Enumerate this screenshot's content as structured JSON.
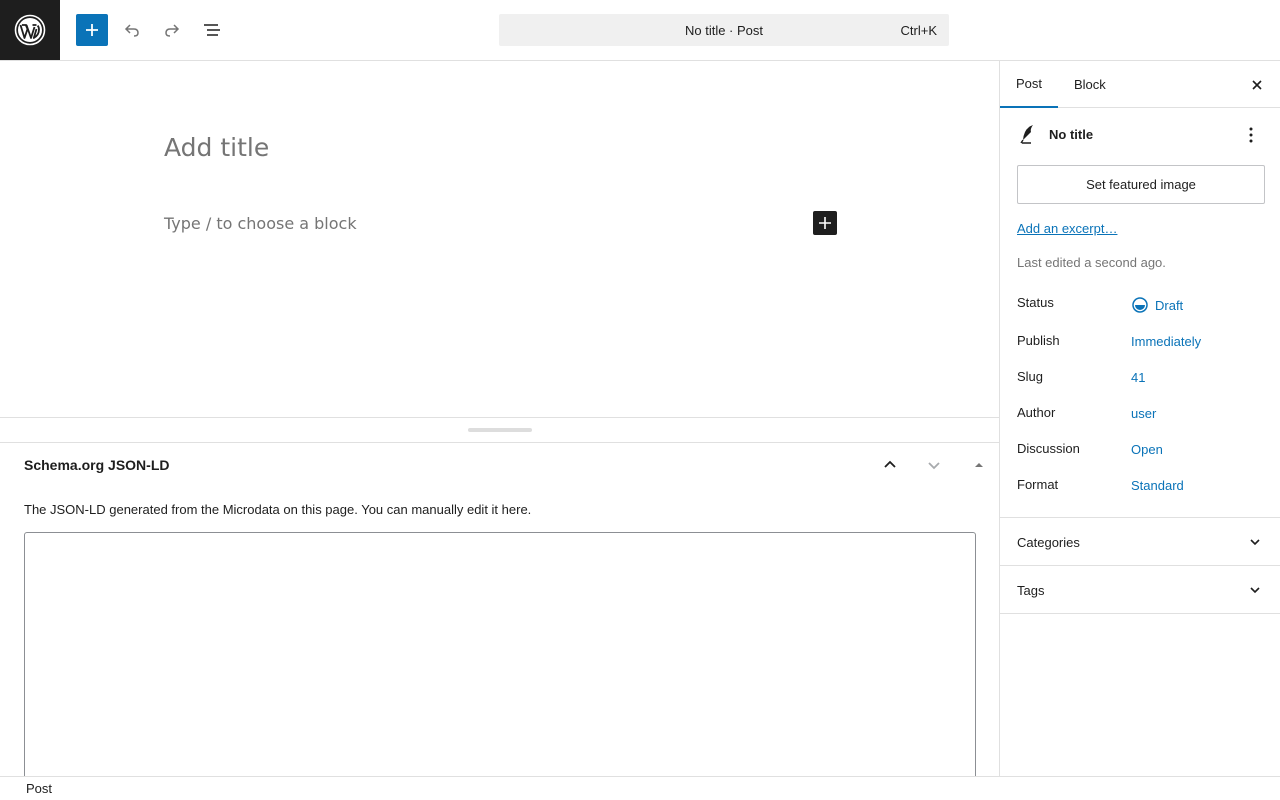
{
  "toolbar": {
    "logo_icon": "wordpress-logo",
    "add_icon": "plus-icon",
    "undo_icon": "undo-icon",
    "redo_icon": "redo-icon",
    "list_icon": "document-overview-icon",
    "command_bar": {
      "label": "No title · Post",
      "shortcut": "Ctrl+K"
    }
  },
  "editor": {
    "title_placeholder": "Add title",
    "block_placeholder": "Type / to choose a block"
  },
  "metabox": {
    "title": "Schema.org JSON-LD",
    "description": "The JSON-LD generated from the Microdata on this page. You can manually edit it here.",
    "textarea_value": ""
  },
  "sidebar": {
    "tabs": [
      {
        "label": "Post",
        "active": true
      },
      {
        "label": "Block",
        "active": false
      }
    ],
    "post_title": "No title",
    "featured_image_label": "Set featured image",
    "excerpt_link": "Add an excerpt…",
    "last_edited": "Last edited a second ago.",
    "rows": [
      {
        "label": "Status",
        "value": "Draft",
        "icon": "draft-circle-icon"
      },
      {
        "label": "Publish",
        "value": "Immediately"
      },
      {
        "label": "Slug",
        "value": "41"
      },
      {
        "label": "Author",
        "value": "user"
      },
      {
        "label": "Discussion",
        "value": "Open"
      },
      {
        "label": "Format",
        "value": "Standard"
      }
    ],
    "panels": [
      {
        "label": "Categories"
      },
      {
        "label": "Tags"
      }
    ]
  },
  "footer": {
    "breadcrumb": "Post"
  },
  "colors": {
    "accent": "#0a73b8",
    "dark": "#1e1e1e",
    "muted": "#757575",
    "border": "#e0e0e0"
  }
}
